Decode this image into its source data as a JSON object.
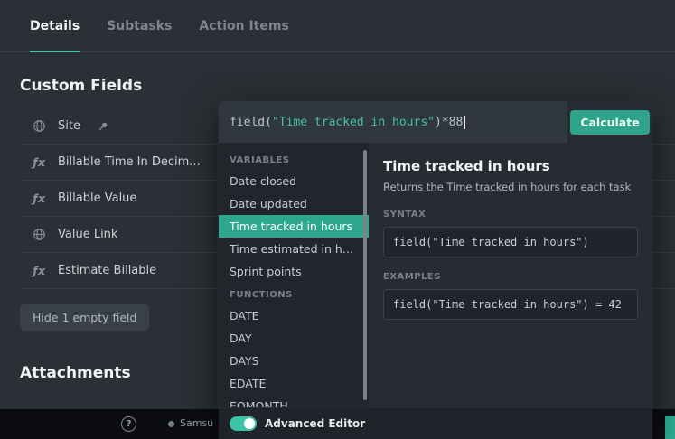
{
  "colors": {
    "accent": "#2fa78e",
    "accent_bright": "#3ec3ab",
    "page_bg": "#2b3036",
    "popup_bg": "#22262c",
    "code_string": "#45c0a8"
  },
  "tabs": {
    "items": [
      {
        "label": "Details",
        "active": true
      },
      {
        "label": "Subtasks",
        "active": false
      },
      {
        "label": "Action Items",
        "active": false
      }
    ]
  },
  "custom_fields": {
    "title": "Custom Fields",
    "fields": [
      {
        "label": "Site",
        "icon": "globe-icon",
        "pinned": true
      },
      {
        "label": "Billable Time In Decim...",
        "icon": "formula-icon",
        "pinned": false
      },
      {
        "label": "Billable Value",
        "icon": "formula-icon",
        "pinned": false
      },
      {
        "label": "Value Link",
        "icon": "globe-icon",
        "pinned": false
      },
      {
        "label": "Estimate Billable",
        "icon": "formula-icon",
        "pinned": false
      }
    ],
    "hide_button_label": "Hide 1 empty field"
  },
  "attachments": {
    "title": "Attachments"
  },
  "icons": {
    "formula_glyph": "ƒx"
  },
  "formula_editor": {
    "input": {
      "prefix": "field(",
      "argument": "\"Time tracked in hours\"",
      "suffix": ")*88"
    },
    "calculate_button": "Calculate",
    "sidebar": {
      "variables_header": "VARIABLES",
      "variables": [
        {
          "label": "Date closed",
          "selected": false
        },
        {
          "label": "Date updated",
          "selected": false
        },
        {
          "label": "Time tracked in hours",
          "selected": true
        },
        {
          "label": "Time estimated in ho...",
          "selected": false
        },
        {
          "label": "Sprint points",
          "selected": false
        }
      ],
      "functions_header": "FUNCTIONS",
      "functions": [
        {
          "label": "DATE"
        },
        {
          "label": "DAY"
        },
        {
          "label": "DAYS"
        },
        {
          "label": "EDATE"
        },
        {
          "label": "EOMONTH"
        }
      ]
    },
    "detail": {
      "title": "Time tracked in hours",
      "description": "Returns the Time tracked in hours for each task",
      "syntax_header": "SYNTAX",
      "syntax_code": "field(\"Time tracked in hours\")",
      "examples_header": "EXAMPLES",
      "example_code": "field(\"Time tracked in hours\") = 42"
    },
    "footer": {
      "advanced_editor_label": "Advanced Editor",
      "advanced_editor_on": true
    }
  },
  "taskbar": {
    "help_label": "?",
    "app_label": "Samsu"
  }
}
